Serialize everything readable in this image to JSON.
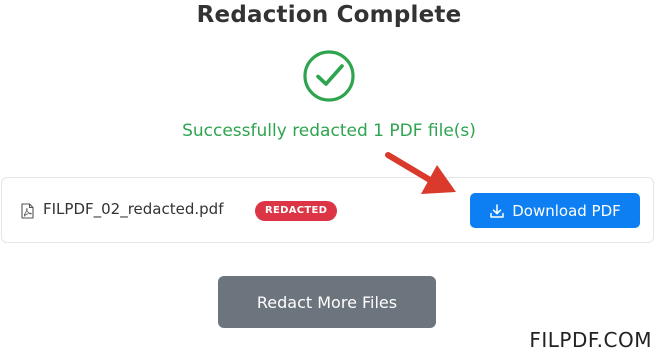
{
  "header": {
    "title": "Redaction Complete"
  },
  "status": {
    "icon": "check-circle-icon",
    "message": "Successfully redacted 1 PDF file(s)"
  },
  "file": {
    "icon": "pdf-file-icon",
    "name": "FILPDF_02_redacted.pdf",
    "badge": "REDACTED"
  },
  "actions": {
    "download_icon": "download-icon",
    "download_label": "Download PDF",
    "more_label": "Redact More Files"
  },
  "annotation": {
    "icon": "red-arrow-icon"
  },
  "watermark": "FILPDF.COM",
  "colors": {
    "success_green": "#2ea44f",
    "badge_red": "#dc3545",
    "download_blue": "#0d7ff2",
    "more_gray": "#6c757d",
    "arrow_red": "#d93a2b"
  }
}
